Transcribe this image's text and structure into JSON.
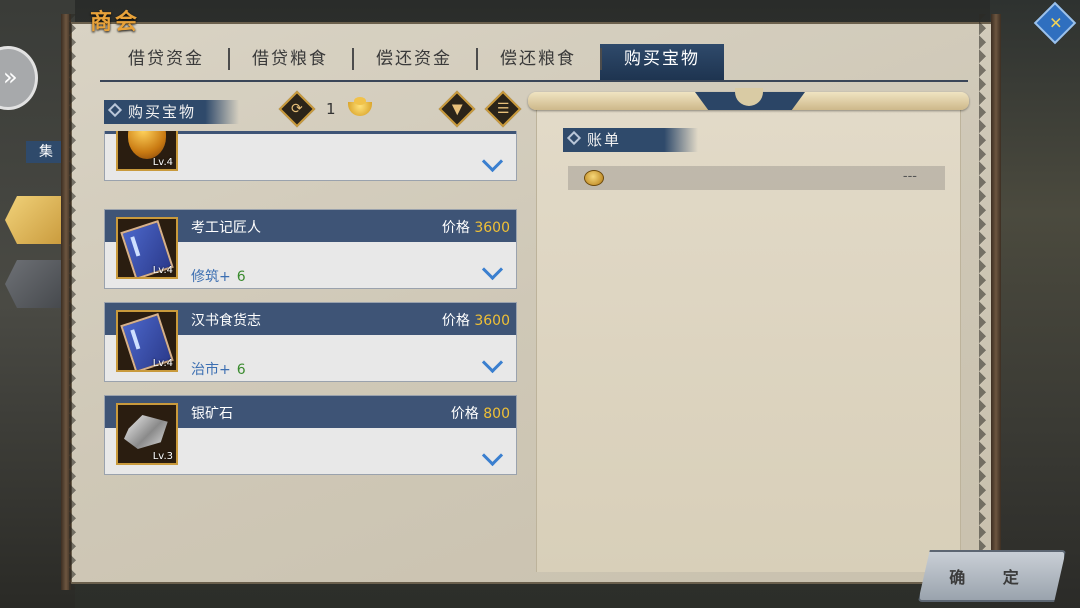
{
  "title": "商会",
  "tabs": [
    {
      "label": "借贷资金"
    },
    {
      "label": "借贷粮食"
    },
    {
      "label": "偿还资金"
    },
    {
      "label": "偿还粮食"
    },
    {
      "label": "购买宝物",
      "active": true
    }
  ],
  "section_title": "购买宝物",
  "counter": {
    "value": "1",
    "icon": "gold-ingot-icon"
  },
  "items": [
    {
      "name": "",
      "price_label": "价格",
      "price": "",
      "level": "Lv.4",
      "effect": "",
      "effect_value": "",
      "icon": "amber-gem-icon"
    },
    {
      "name": "考工记匠人",
      "price_label": "价格",
      "price": "3600",
      "level": "Lv.4",
      "effect": "修筑+",
      "effect_value": "6",
      "icon": "blue-book-icon"
    },
    {
      "name": "汉书食货志",
      "price_label": "价格",
      "price": "3600",
      "level": "Lv.4",
      "effect": "治市+",
      "effect_value": "6",
      "icon": "blue-book-icon"
    },
    {
      "name": "银矿石",
      "price_label": "价格",
      "price": "800",
      "level": "Lv.3",
      "effect": "",
      "effect_value": "",
      "icon": "silver-ore-icon"
    }
  ],
  "bill": {
    "title": "账单",
    "row_value": "---",
    "row_icon": "coin-icon"
  },
  "confirm_label": "确 定",
  "side": {
    "tag": "集"
  },
  "colors": {
    "accent_blue": "#3e5476",
    "gold": "#f0c036",
    "effect_blue": "#3c6fb2",
    "effect_green": "#3a8b2e",
    "title_orange": "#e8a23a"
  }
}
